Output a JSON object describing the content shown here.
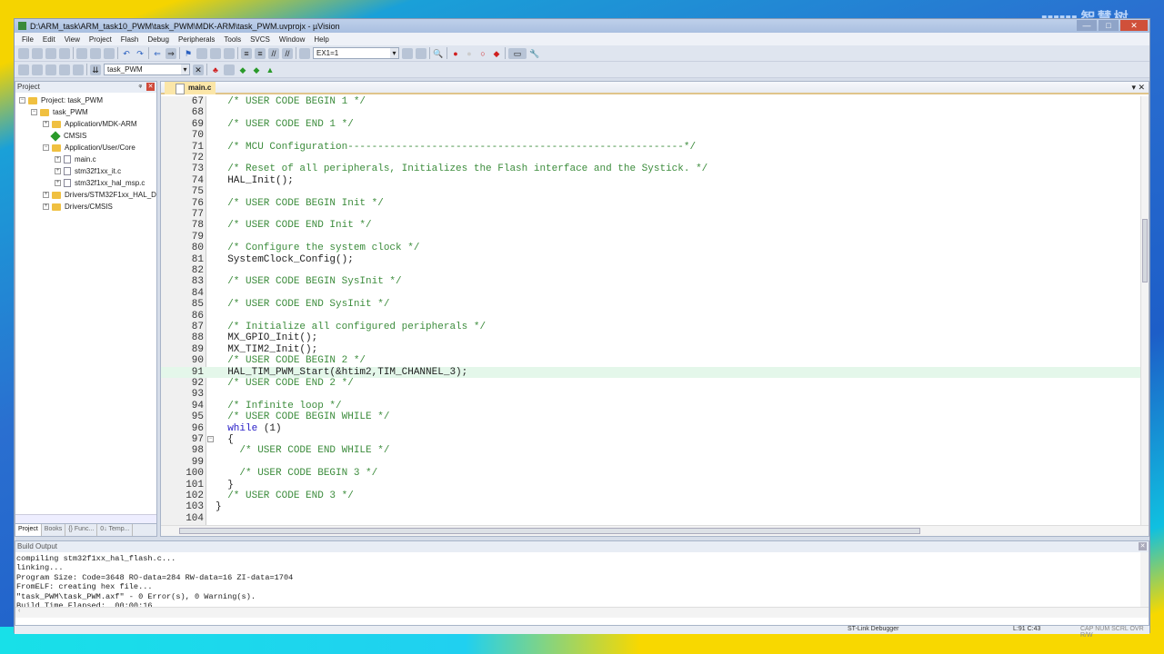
{
  "watermark": "智慧树",
  "window": {
    "title": "D:\\ARM_task\\ARM_task10_PWM\\task_PWM\\MDK-ARM\\task_PWM.uvprojx - µVision",
    "controls": [
      "—",
      "□",
      "✕"
    ]
  },
  "menu": [
    "File",
    "Edit",
    "View",
    "Project",
    "Flash",
    "Debug",
    "Peripherals",
    "Tools",
    "SVCS",
    "Window",
    "Help"
  ],
  "toolbar": {
    "find_combo": "EX1=1",
    "target_combo": "task_PWM"
  },
  "project": {
    "header": "Project",
    "tree": [
      {
        "label": "Project: task_PWM",
        "level": 0,
        "expander": "⊟",
        "icon": "project"
      },
      {
        "label": "task_PWM",
        "level": 1,
        "expander": "⊟",
        "icon": "folder"
      },
      {
        "label": "Application/MDK-ARM",
        "level": 2,
        "expander": "⊞",
        "icon": "folder"
      },
      {
        "label": "CMSIS",
        "level": 2,
        "expander": "",
        "icon": "diamond"
      },
      {
        "label": "Application/User/Core",
        "level": 2,
        "expander": "⊟",
        "icon": "folder"
      },
      {
        "label": "main.c",
        "level": 3,
        "expander": "⊞",
        "icon": "file"
      },
      {
        "label": "stm32f1xx_it.c",
        "level": 3,
        "expander": "⊞",
        "icon": "file"
      },
      {
        "label": "stm32f1xx_hal_msp.c",
        "level": 3,
        "expander": "⊞",
        "icon": "file"
      },
      {
        "label": "Drivers/STM32F1xx_HAL_Driver",
        "level": 2,
        "expander": "⊞",
        "icon": "folder"
      },
      {
        "label": "Drivers/CMSIS",
        "level": 2,
        "expander": "⊞",
        "icon": "folder"
      }
    ],
    "tabs": [
      "Project",
      "Books",
      "{} Func...",
      "0↓ Temp..."
    ]
  },
  "editor": {
    "tab": "main.c",
    "highlight_line": 91,
    "lines": [
      {
        "n": 67,
        "t": "  /* USER CODE BEGIN 1 */",
        "c": 1
      },
      {
        "n": 68,
        "t": ""
      },
      {
        "n": 69,
        "t": "  /* USER CODE END 1 */",
        "c": 1
      },
      {
        "n": 70,
        "t": ""
      },
      {
        "n": 71,
        "t": "  /* MCU Configuration--------------------------------------------------------*/",
        "c": 1
      },
      {
        "n": 72,
        "t": ""
      },
      {
        "n": 73,
        "t": "  /* Reset of all peripherals, Initializes the Flash interface and the Systick. */",
        "c": 1
      },
      {
        "n": 74,
        "t": "  HAL_Init();"
      },
      {
        "n": 75,
        "t": ""
      },
      {
        "n": 76,
        "t": "  /* USER CODE BEGIN Init */",
        "c": 1
      },
      {
        "n": 77,
        "t": ""
      },
      {
        "n": 78,
        "t": "  /* USER CODE END Init */",
        "c": 1
      },
      {
        "n": 79,
        "t": ""
      },
      {
        "n": 80,
        "t": "  /* Configure the system clock */",
        "c": 1
      },
      {
        "n": 81,
        "t": "  SystemClock_Config();"
      },
      {
        "n": 82,
        "t": ""
      },
      {
        "n": 83,
        "t": "  /* USER CODE BEGIN SysInit */",
        "c": 1
      },
      {
        "n": 84,
        "t": ""
      },
      {
        "n": 85,
        "t": "  /* USER CODE END SysInit */",
        "c": 1
      },
      {
        "n": 86,
        "t": ""
      },
      {
        "n": 87,
        "t": "  /* Initialize all configured peripherals */",
        "c": 1
      },
      {
        "n": 88,
        "t": "  MX_GPIO_Init();"
      },
      {
        "n": 89,
        "t": "  MX_TIM2_Init();"
      },
      {
        "n": 90,
        "t": "  /* USER CODE BEGIN 2 */",
        "c": 1
      },
      {
        "n": 91,
        "t": "  HAL_TIM_PWM_Start(&htim2,TIM_CHANNEL_3);"
      },
      {
        "n": 92,
        "t": "  /* USER CODE END 2 */",
        "c": 1
      },
      {
        "n": 93,
        "t": ""
      },
      {
        "n": 94,
        "t": "  /* Infinite loop */",
        "c": 1
      },
      {
        "n": 95,
        "t": "  /* USER CODE BEGIN WHILE */",
        "c": 1
      },
      {
        "n": 96,
        "t": "  while (1)",
        "kw": "while"
      },
      {
        "n": 97,
        "t": "  {",
        "fold": "⊟"
      },
      {
        "n": 98,
        "t": "    /* USER CODE END WHILE */",
        "c": 1
      },
      {
        "n": 99,
        "t": ""
      },
      {
        "n": 100,
        "t": "    /* USER CODE BEGIN 3 */",
        "c": 1
      },
      {
        "n": 101,
        "t": "  }"
      },
      {
        "n": 102,
        "t": "  /* USER CODE END 3 */",
        "c": 1
      },
      {
        "n": 103,
        "t": "}"
      },
      {
        "n": 104,
        "t": ""
      }
    ]
  },
  "build_output": {
    "header": "Build Output",
    "lines": [
      "compiling stm32f1xx_hal_flash.c...",
      "linking...",
      "Program Size: Code=3648 RO-data=284 RW-data=16 ZI-data=1704",
      "FromELF: creating hex file...",
      "\"task_PWM\\task_PWM.axf\" - 0 Error(s), 0 Warning(s).",
      "Build Time Elapsed:  00:00:16"
    ]
  },
  "status": {
    "debugger": "ST-Link Debugger",
    "position": "L:91 C:43",
    "indicators": "CAP  NUM  SCRL  OVR  R/W"
  },
  "colors": {
    "comment": "#3c8c3c",
    "keyword": "#2a20c8",
    "highlight": "#e4f7ea",
    "active_tab": "#fbe6a8"
  }
}
